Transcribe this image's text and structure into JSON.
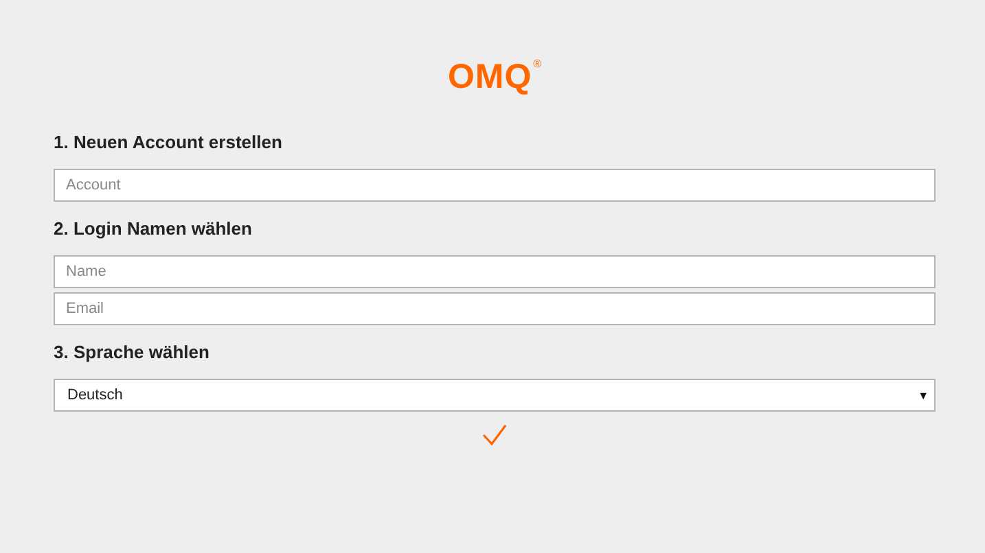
{
  "logo": {
    "text": "OMQ",
    "mark": "®"
  },
  "sections": [
    {
      "heading": "1. Neuen Account erstellen",
      "fields": [
        {
          "kind": "input",
          "placeholder": "Account"
        }
      ]
    },
    {
      "heading": "2. Login Namen wählen",
      "fields": [
        {
          "kind": "input",
          "placeholder": "Name"
        },
        {
          "kind": "input",
          "placeholder": "Email"
        }
      ]
    },
    {
      "heading": "3. Sprache wählen",
      "fields": [
        {
          "kind": "select",
          "value": "Deutsch",
          "caret": "▼"
        }
      ]
    }
  ]
}
